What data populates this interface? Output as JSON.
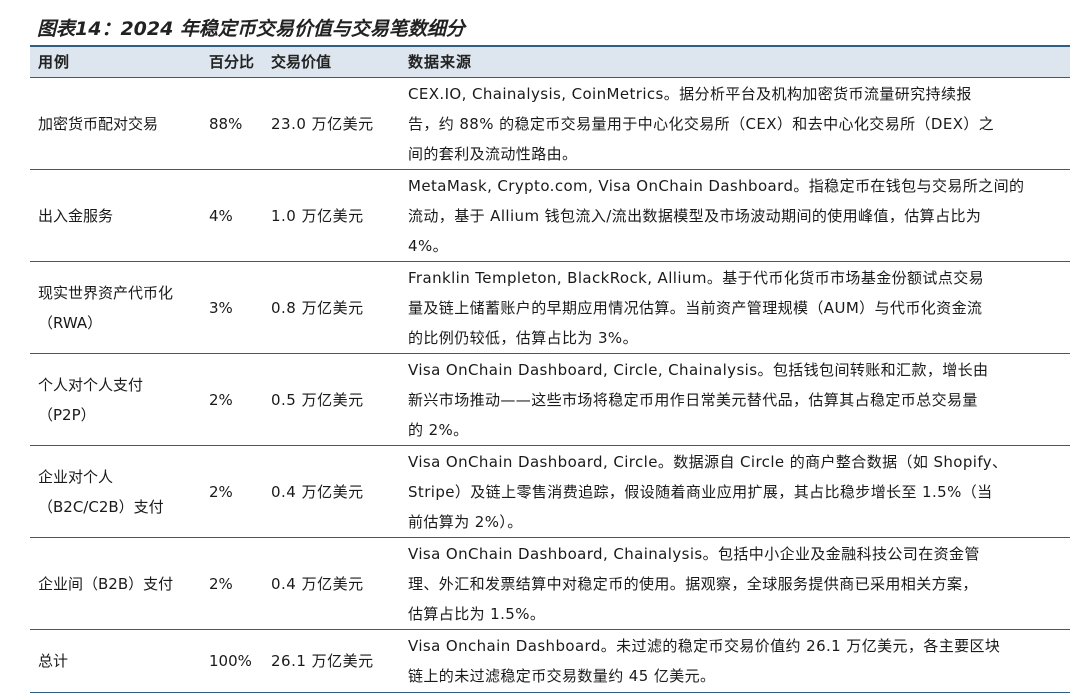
{
  "title": "图表14：2024 年稳定币交易价值与交易笔数细分",
  "headers": {
    "use": "用例",
    "pct": "百分比",
    "value": "交易价值",
    "source": "数据来源"
  },
  "rows": [
    {
      "use": [
        "加密货币配对交易"
      ],
      "pct": "88%",
      "value": "23.0 万亿美元",
      "source": [
        "CEX.IO, Chainalysis, CoinMetrics。据分析平台及机构加密货币流量研究持续报",
        "告，约 88% 的稳定币交易量用于中心化交易所（CEX）和去中心化交易所（DEX）之",
        "间的套利及流动性路由。"
      ]
    },
    {
      "use": [
        "出入金服务"
      ],
      "pct": "4%",
      "value": "1.0 万亿美元",
      "source": [
        "MetaMask, Crypto.com, Visa OnChain Dashboard。指稳定币在钱包与交易所之间的",
        "流动，基于 Allium 钱包流入/流出数据模型及市场波动期间的使用峰值，估算占比为",
        "4%。"
      ]
    },
    {
      "use": [
        "现实世界资产代币化",
        "（RWA）"
      ],
      "pct": "3%",
      "value": "0.8 万亿美元",
      "source": [
        "Franklin Templeton, BlackRock, Allium。基于代币化货币市场基金份额试点交易",
        "量及链上储蓄账户的早期应用情况估算。当前资产管理规模（AUM）与代币化资金流",
        "的比例仍较低，估算占比为 3%。"
      ]
    },
    {
      "use": [
        "个人对个人支付",
        "（P2P）"
      ],
      "pct": "2%",
      "value": "0.5 万亿美元",
      "source": [
        "Visa OnChain Dashboard, Circle, Chainalysis。包括钱包间转账和汇款，增长由",
        "新兴市场推动——这些市场将稳定币用作日常美元替代品，估算其占稳定币总交易量",
        "的 2%。"
      ]
    },
    {
      "use": [
        "企业对个人",
        "（B2C/C2B）支付"
      ],
      "pct": "2%",
      "value": "0.4 万亿美元",
      "source": [
        "Visa OnChain Dashboard, Circle。数据源自 Circle 的商户整合数据（如 Shopify、",
        "Stripe）及链上零售消费追踪，假设随着商业应用扩展，其占比稳步增长至 1.5%（当",
        "前估算为 2%）。"
      ]
    },
    {
      "use": [
        "企业间（B2B）支付"
      ],
      "pct": "2%",
      "value": "0.4 万亿美元",
      "source": [
        "Visa OnChain Dashboard, Chainalysis。包括中小企业及金融科技公司在资金管",
        "理、外汇和发票结算中对稳定币的使用。据观察，全球服务提供商已采用相关方案，",
        "估算占比为 1.5%。"
      ]
    },
    {
      "use": [
        "总计"
      ],
      "pct": "100%",
      "value": "26.1 万亿美元",
      "source": [
        "Visa Onchain Dashboard。未过滤的稳定币交易价值约 26.1 万亿美元，各主要区块",
        "链上的未过滤稳定币交易数量约 45 亿美元。"
      ]
    }
  ]
}
